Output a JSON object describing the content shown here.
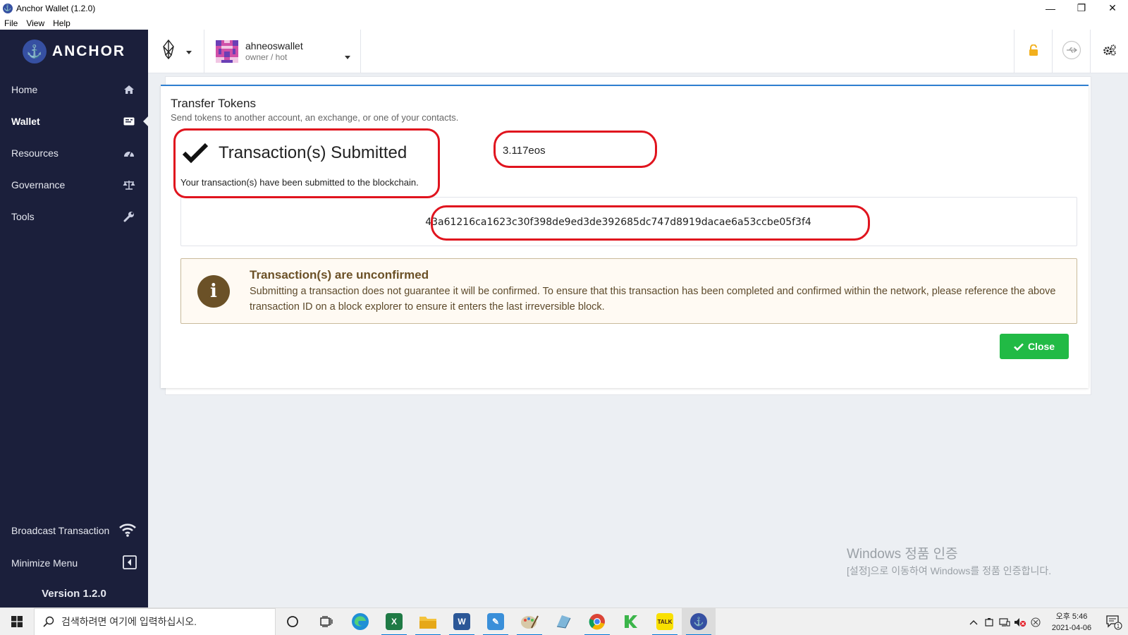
{
  "window": {
    "title": "Anchor Wallet (1.2.0)",
    "controls": [
      "minimize",
      "restore",
      "close"
    ]
  },
  "menubar": {
    "items": [
      "File",
      "View",
      "Help"
    ]
  },
  "sidebar": {
    "brand": "ANCHOR",
    "items": [
      {
        "label": "Home",
        "icon": "home-icon"
      },
      {
        "label": "Wallet",
        "icon": "wallet-icon",
        "active": true
      },
      {
        "label": "Resources",
        "icon": "gauge-icon"
      },
      {
        "label": "Governance",
        "icon": "balance-scale-icon"
      },
      {
        "label": "Tools",
        "icon": "wrench-icon"
      }
    ],
    "broadcast_label": "Broadcast Transaction",
    "minimize_label": "Minimize Menu",
    "version": "Version 1.2.0"
  },
  "appbar": {
    "account_name": "ahneoswallet",
    "account_permission": "owner / hot",
    "icons": [
      "eos-chain-icon",
      "lock-icon",
      "usb-icon",
      "settings-icon"
    ],
    "lock_color": "#f2b01e"
  },
  "transfer": {
    "title": "Transfer Tokens",
    "subtitle": "Send tokens to another account, an exchange, or one of your contacts.",
    "status_title": "Transaction(s) Submitted",
    "status_desc": "Your transaction(s) have been submitted to the blockchain.",
    "amount_note": "3.117eos",
    "txid": "43a61216ca1623c30f398de9ed3de392685dc747d8919dacae6a53ccbe05f3f4",
    "warning_title": "Transaction(s) are unconfirmed",
    "warning_text": "Submitting a transaction does not guarantee it will be confirmed. To ensure that this transaction has been completed and confirmed within the network, please reference the above transaction ID on a block explorer to ensure it enters the last irreversible block.",
    "close_label": "Close",
    "accent_color": "#21ba45",
    "annotation_color": "#e0141e"
  },
  "watermark": {
    "line1": "Windows 정품 인증",
    "line2": "[설정]으로 이동하여 Windows를 정품 인증합니다."
  },
  "taskbar": {
    "search_placeholder": "검색하려면 여기에 입력하십시오.",
    "apps": [
      "edge-icon",
      "excel-icon",
      "file-explorer-icon",
      "word-icon",
      "notepad-icon",
      "paint-icon",
      "app-icon",
      "chrome-icon",
      "kakao-green-icon",
      "kakaotalk-icon",
      "anchor-icon"
    ],
    "clock_time": "오후 5:46",
    "clock_date": "2021-04-06",
    "notification_count": "1"
  }
}
